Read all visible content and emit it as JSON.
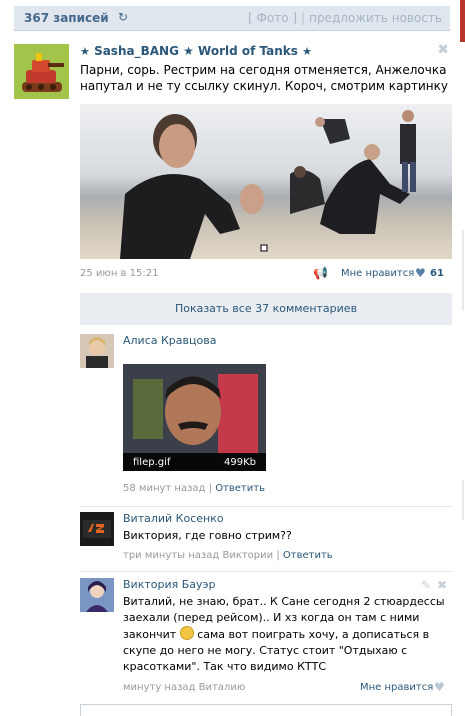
{
  "header": {
    "count": "367 записей",
    "refresh_icon": "refresh-icon",
    "photo_link": "[ Фото ]",
    "separator": "|",
    "suggest_link": "предложить новость"
  },
  "post": {
    "author_name": "Sasha_BANG ★ World of Tanks",
    "star": "★",
    "text": "Парни, сорь. Рестрим на сегодня отменяется, Анжелочка напутал и не ту ссылку скинул. Короч, смотрим картинку",
    "date": "25 июн в 15:21",
    "like_label": "Мне нравится",
    "like_count": "61",
    "close_icon": "close-icon"
  },
  "show_all_comments": "Показать все 37 комментариев",
  "comments": [
    {
      "author": "Алиса Кравцова",
      "attachment_name": "filep.gif",
      "attachment_size": "499Kb",
      "time": "58 минут назад",
      "separator": "|",
      "reply": "Ответить"
    },
    {
      "author": "Виталий Косенко",
      "text": "Виктория, где говно стрим??",
      "time": "три минуты назад Виктории",
      "separator": "|",
      "reply": "Ответить"
    },
    {
      "author": "Виктория Бауэр",
      "text_part1": "Виталий, не знаю, брат.. К Сане сегодня 2 стюардессы заехали (перед рейсом).. И хз когда он там с ними закончит",
      "text_part2": "сама вот поиграть хочу, а дописаться в скупе до него не могу. Статус стоит \"Отдыхаю с красотками\". Так что видимо КТТС",
      "time": "минуту назад Виталию",
      "like_label": "Мне нравится"
    }
  ]
}
